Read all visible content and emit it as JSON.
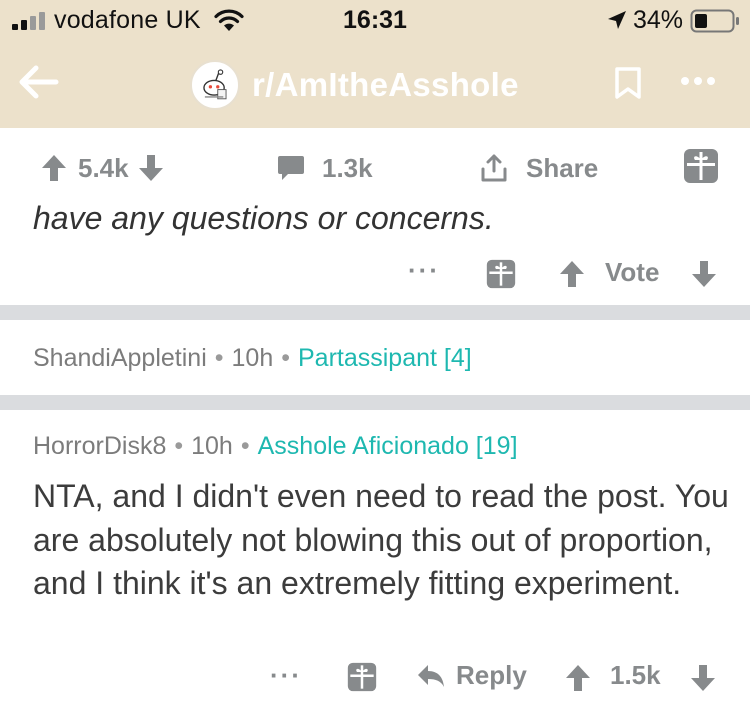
{
  "status_bar": {
    "carrier": "vodafone UK",
    "time": "16:31",
    "battery_percent": "34%",
    "battery_level": 0.34,
    "signal_bars": 4,
    "signal_bars_filled": 2
  },
  "nav": {
    "subreddit": "r/AmItheAsshole"
  },
  "post_actions": {
    "score": "5.4k",
    "comments": "1.3k",
    "share_label": "Share"
  },
  "continued_comment": {
    "text_tail": "have any questions or concerns.",
    "more": "···",
    "vote_label": "Vote"
  },
  "collapsed_comment": {
    "author": "ShandiAppletini",
    "age": "10h",
    "flair": "Partassipant [4]"
  },
  "comment": {
    "author": "HorrorDisk8",
    "age": "10h",
    "flair": "Asshole Aficionado [19]",
    "body": "NTA, and I didn't even need to read the post. You are absolutely not blowing this out of proportion, and I think it's an extremely fitting experiment.",
    "more": "···",
    "reply_label": "Reply",
    "score": "1.5k"
  },
  "separator": "•",
  "colors": {
    "header_bg": "#ece1cb",
    "flair_teal": "#1eb8b0",
    "icon_gray": "#878a8c",
    "divider": "#dadcdf"
  },
  "icons": [
    "signal-icon",
    "wifi-icon",
    "location-arrow-icon",
    "battery-icon",
    "back-arrow-icon",
    "subreddit-avatar-icon",
    "bookmark-icon",
    "more-icon",
    "upvote-icon",
    "downvote-icon",
    "comment-bubble-icon",
    "share-icon",
    "gift-icon",
    "reply-icon"
  ]
}
